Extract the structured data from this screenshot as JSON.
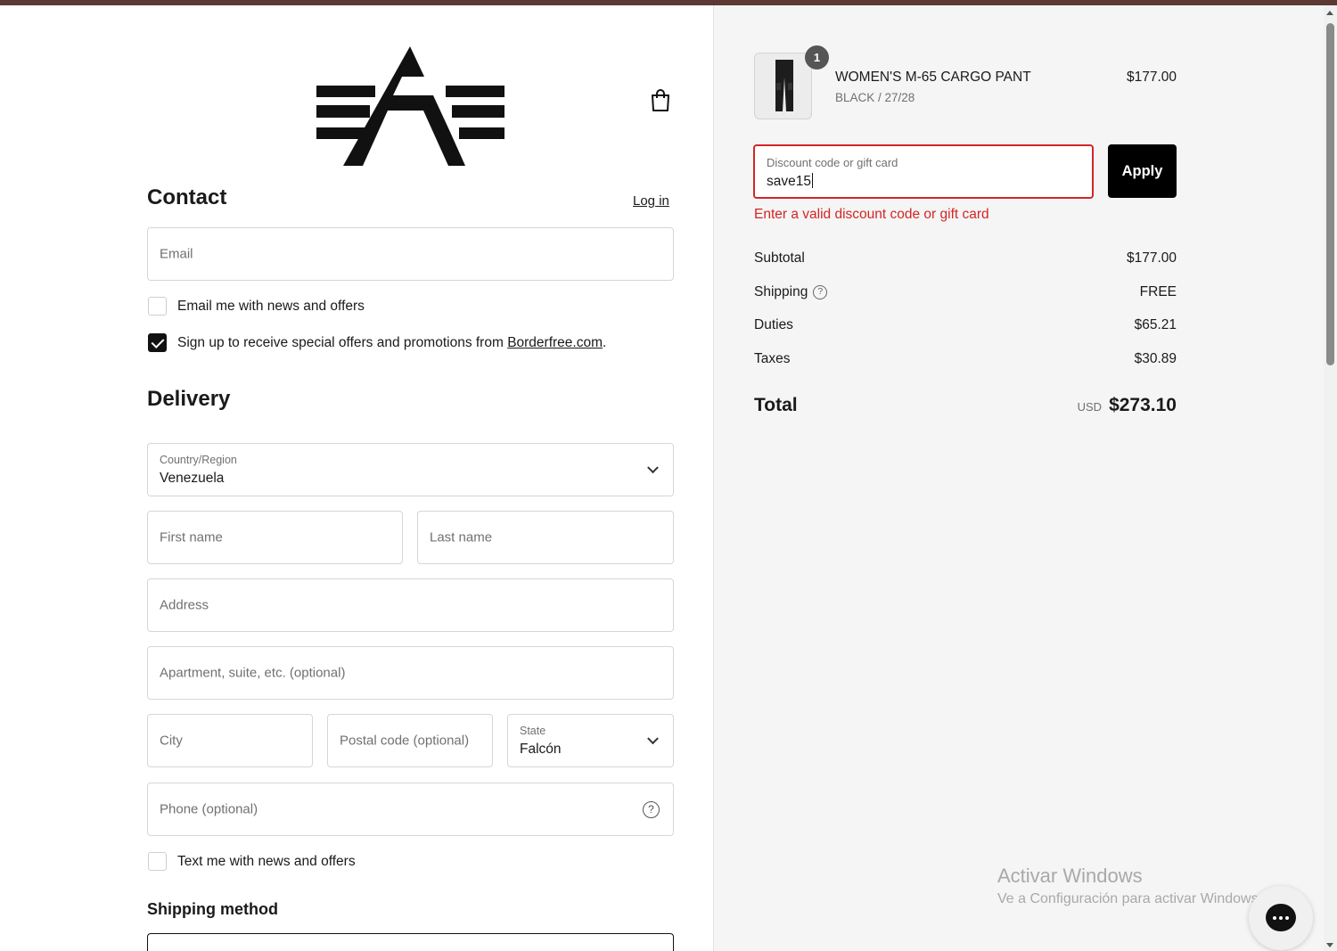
{
  "contact": {
    "heading": "Contact",
    "login_link": "Log in",
    "email_placeholder": "Email",
    "email_news_label": "Email me with news and offers",
    "email_news_checked": false,
    "borderfree_label_prefix": "Sign up to receive special offers and promotions from ",
    "borderfree_link": "Borderfree.com",
    "borderfree_label_suffix": ".",
    "borderfree_checked": true
  },
  "delivery": {
    "heading": "Delivery",
    "country_label": "Country/Region",
    "country_value": "Venezuela",
    "first_name_placeholder": "First name",
    "last_name_placeholder": "Last name",
    "address_placeholder": "Address",
    "apartment_placeholder": "Apartment, suite, etc. (optional)",
    "city_placeholder": "City",
    "postal_placeholder": "Postal code (optional)",
    "state_label": "State",
    "state_value": "Falcón",
    "phone_placeholder": "Phone (optional)",
    "text_news_label": "Text me with news and offers",
    "text_news_checked": false
  },
  "shipping_method": {
    "heading": "Shipping method"
  },
  "order": {
    "quantity": "1",
    "product_name": "WOMEN'S M-65 CARGO PANT",
    "product_variant": "BLACK / 27/28",
    "product_price": "$177.00",
    "discount_label": "Discount code or gift card",
    "discount_value": "save15",
    "apply_label": "Apply",
    "discount_error": "Enter a valid discount code or gift card",
    "subtotal_label": "Subtotal",
    "subtotal_value": "$177.00",
    "shipping_label": "Shipping",
    "shipping_value": "FREE",
    "duties_label": "Duties",
    "duties_value": "$65.21",
    "taxes_label": "Taxes",
    "taxes_value": "$30.89",
    "total_label": "Total",
    "total_currency": "USD",
    "total_value": "$273.10"
  },
  "windows_watermark": {
    "title": "Activar Windows",
    "subtitle": "Ve a Configuración para activar Windows."
  },
  "colors": {
    "error": "#d32525",
    "button_bg": "#000000",
    "right_panel_bg": "#f5f5f5",
    "top_bar": "#5a3a33"
  },
  "icons": [
    "alpha-industries-logo",
    "shopping-bag-icon",
    "chevron-down-icon",
    "question-circle-icon",
    "chat-icon"
  ]
}
